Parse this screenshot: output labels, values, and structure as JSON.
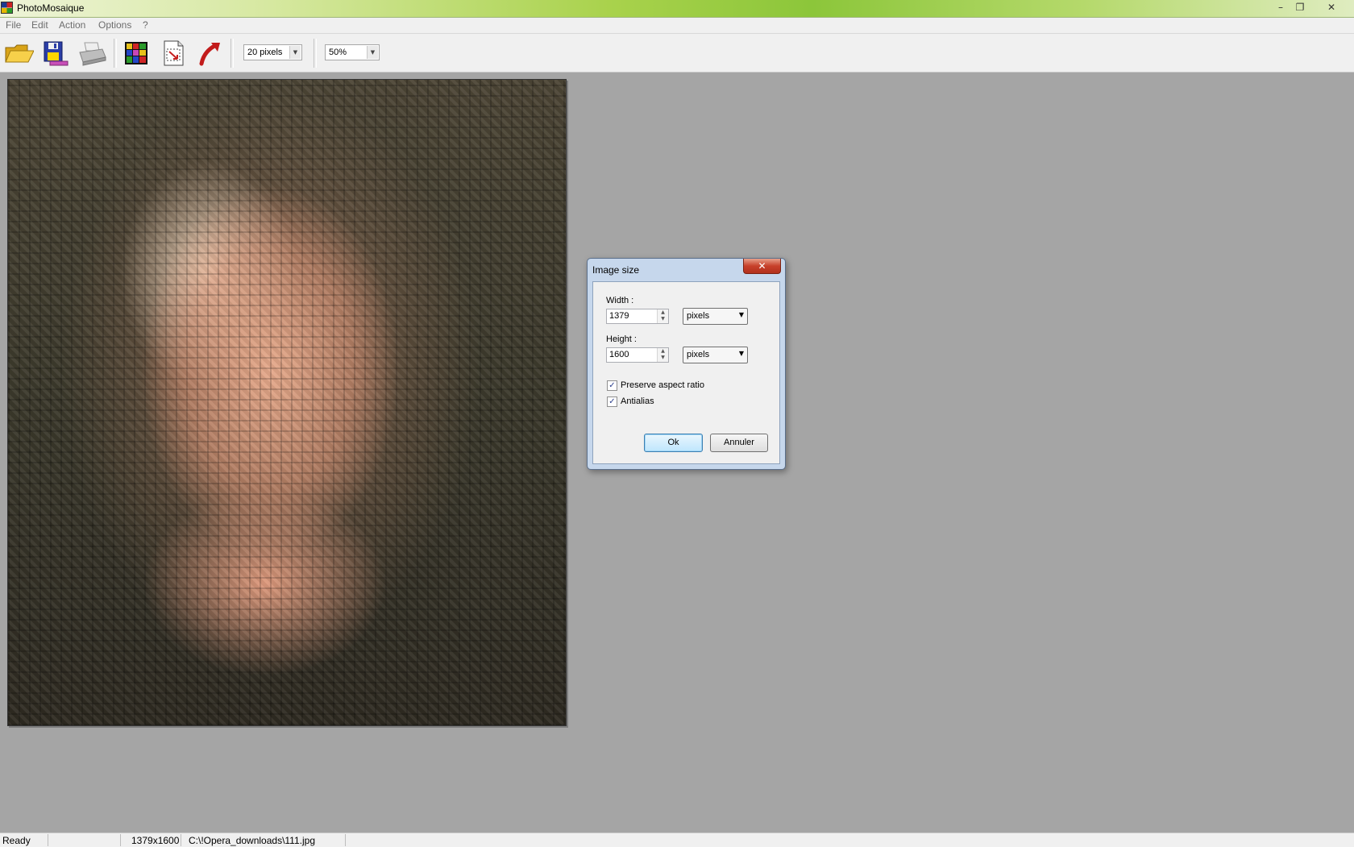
{
  "window": {
    "title": "PhotoMosaique",
    "controls": {
      "minimize": "–",
      "restore": "❐",
      "close": "✕"
    }
  },
  "menubar": {
    "items": [
      "File",
      "Edit",
      "Action",
      "Options",
      "?"
    ]
  },
  "toolbar": {
    "buttons": [
      {
        "name": "open-folder",
        "icon": "folder-open-icon"
      },
      {
        "name": "save",
        "icon": "floppy-disk-icon"
      },
      {
        "name": "print",
        "icon": "printer-icon"
      },
      {
        "name": "mosaic",
        "icon": "mosaic-grid-icon"
      },
      {
        "name": "image-size",
        "icon": "resize-document-icon"
      },
      {
        "name": "undo",
        "icon": "undo-arrow-icon"
      }
    ],
    "tile_size": "20 pixels",
    "zoom": "50%"
  },
  "dialog": {
    "title": "Image size",
    "close": "✕",
    "width_label": "Width :",
    "width_value": "1379",
    "width_unit": "pixels",
    "height_label": "Height :",
    "height_value": "1600",
    "height_unit": "pixels",
    "preserve_label": "Preserve aspect ratio",
    "preserve_checked": true,
    "antialias_label": "Antialias",
    "antialias_checked": true,
    "ok_label": "Ok",
    "cancel_label": "Annuler"
  },
  "statusbar": {
    "state": "Ready",
    "dimensions": "1379x1600",
    "path": "C:\\!Opera_downloads\\111.jpg"
  }
}
